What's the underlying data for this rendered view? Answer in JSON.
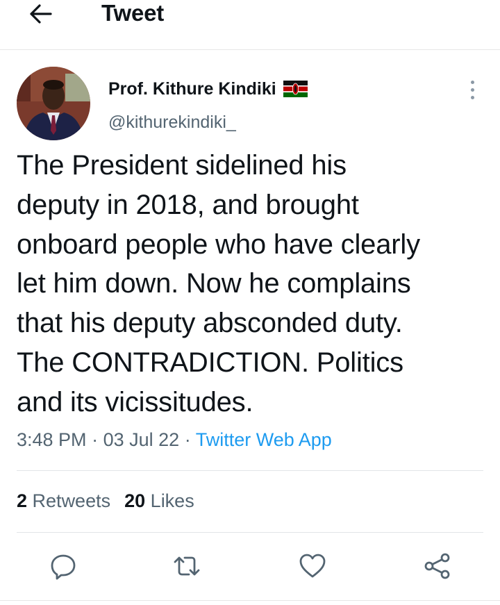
{
  "header": {
    "title": "Tweet",
    "back_icon": "arrow-left-icon"
  },
  "author": {
    "display_name": "Prof. Kithure Kindiki",
    "handle": "@kithurekindiki_",
    "flag_icon": "kenya-flag-icon",
    "more_icon": "more-vertical-icon"
  },
  "tweet": {
    "text": "The President sidelined his\ndeputy in 2018, and brought\nonboard people who have clearly\nlet him down. Now he complains\nthat his deputy absconded duty.\nThe CONTRADICTION. Politics\nand its vicissitudes.",
    "time": "3:48 PM",
    "date": "03 Jul 22",
    "separator": "·",
    "source": "Twitter Web App"
  },
  "stats": {
    "retweets_count": "2",
    "retweets_label": "Retweets",
    "likes_count": "20",
    "likes_label": "Likes"
  },
  "actions": [
    {
      "name": "reply",
      "icon": "reply-icon"
    },
    {
      "name": "retweet",
      "icon": "retweet-icon"
    },
    {
      "name": "like",
      "icon": "heart-icon"
    },
    {
      "name": "share",
      "icon": "share-icon"
    }
  ],
  "colors": {
    "link": "#1d9bf0",
    "secondary_text": "#536471",
    "primary_text": "#0f1419"
  }
}
